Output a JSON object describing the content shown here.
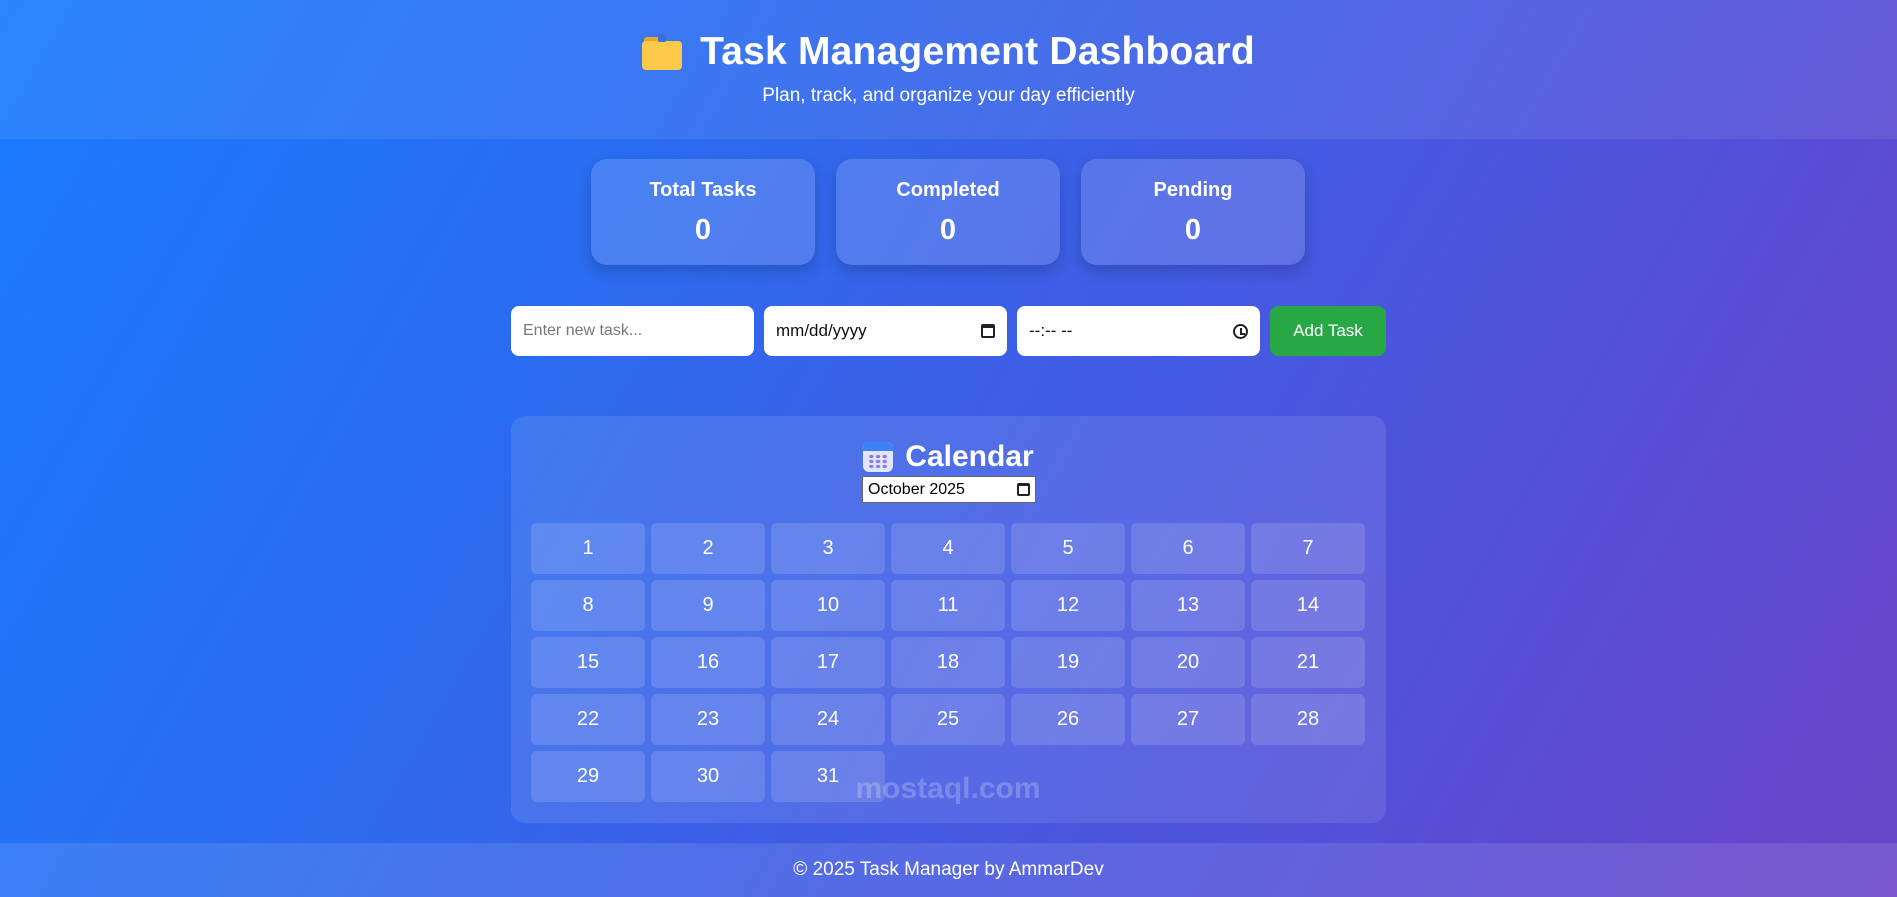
{
  "header": {
    "title": "Task Management Dashboard",
    "subtitle": "Plan, track, and organize your day efficiently",
    "icon": "folder-icon"
  },
  "stats": [
    {
      "label": "Total Tasks",
      "value": "0"
    },
    {
      "label": "Completed",
      "value": "0"
    },
    {
      "label": "Pending",
      "value": "0"
    }
  ],
  "form": {
    "task_placeholder": "Enter new task...",
    "date_placeholder": "mm/dd/yyyy",
    "time_placeholder": "--:-- --",
    "add_label": "Add Task"
  },
  "calendar": {
    "title": "Calendar",
    "icon": "calendar-icon",
    "month_value": "October 2025",
    "days": [
      "1",
      "2",
      "3",
      "4",
      "5",
      "6",
      "7",
      "8",
      "9",
      "10",
      "11",
      "12",
      "13",
      "14",
      "15",
      "16",
      "17",
      "18",
      "19",
      "20",
      "21",
      "22",
      "23",
      "24",
      "25",
      "26",
      "27",
      "28",
      "29",
      "30",
      "31"
    ]
  },
  "watermark": "mostaql.com",
  "footer": {
    "text": "© 2025 Task Manager by AmmarDev"
  },
  "colors": {
    "accent_green": "#28a745",
    "bg_start": "#1a7bff",
    "bg_end": "#6a45c8"
  }
}
